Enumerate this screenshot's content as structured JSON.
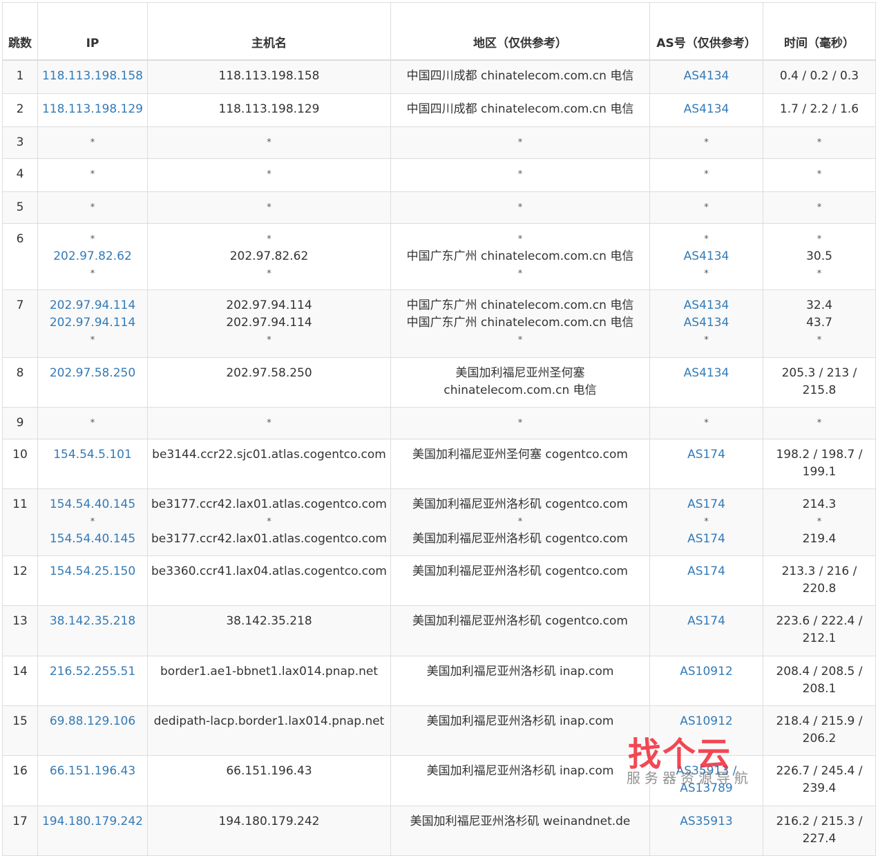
{
  "headers": [
    "跳数",
    "IP",
    "主机名",
    "地区（仅供参考）",
    "AS号（仅供参考）",
    "时间（毫秒）"
  ],
  "link_color": "#337ab7",
  "rows": [
    {
      "hop": "1",
      "ip": [
        "118.113.198.158"
      ],
      "host": [
        "118.113.198.158"
      ],
      "region": [
        "中国四川成都 chinatelecom.com.cn 电信"
      ],
      "asn": [
        "AS4134"
      ],
      "time": [
        "0.4 / 0.2 / 0.3"
      ]
    },
    {
      "hop": "2",
      "ip": [
        "118.113.198.129"
      ],
      "host": [
        "118.113.198.129"
      ],
      "region": [
        "中国四川成都 chinatelecom.com.cn 电信"
      ],
      "asn": [
        "AS4134"
      ],
      "time": [
        "1.7 / 2.2 / 1.6"
      ]
    },
    {
      "hop": "3",
      "ip": [
        "*"
      ],
      "host": [
        "*"
      ],
      "region": [
        "*"
      ],
      "asn": [
        "*"
      ],
      "time": [
        "*"
      ]
    },
    {
      "hop": "4",
      "ip": [
        "*"
      ],
      "host": [
        "*"
      ],
      "region": [
        "*"
      ],
      "asn": [
        "*"
      ],
      "time": [
        "*"
      ]
    },
    {
      "hop": "5",
      "ip": [
        "*"
      ],
      "host": [
        "*"
      ],
      "region": [
        "*"
      ],
      "asn": [
        "*"
      ],
      "time": [
        "*"
      ]
    },
    {
      "hop": "6",
      "ip": [
        "*",
        "202.97.82.62",
        "*"
      ],
      "host": [
        "*",
        "202.97.82.62",
        "*"
      ],
      "region": [
        "*",
        "中国广东广州 chinatelecom.com.cn 电信",
        "*"
      ],
      "asn": [
        "*",
        "AS4134",
        "*"
      ],
      "time": [
        "*",
        "30.5",
        "*"
      ]
    },
    {
      "hop": "7",
      "ip": [
        "202.97.94.114",
        "202.97.94.114",
        "*"
      ],
      "host": [
        "202.97.94.114",
        "202.97.94.114",
        "*"
      ],
      "region": [
        "中国广东广州 chinatelecom.com.cn 电信",
        "中国广东广州 chinatelecom.com.cn 电信",
        "*"
      ],
      "asn": [
        "AS4134",
        "AS4134",
        "*"
      ],
      "time": [
        "32.4",
        "43.7",
        "*"
      ]
    },
    {
      "hop": "8",
      "ip": [
        "202.97.58.250"
      ],
      "host": [
        "202.97.58.250"
      ],
      "region": [
        "美国加利福尼亚州圣何塞",
        "chinatelecom.com.cn 电信"
      ],
      "asn": [
        "AS4134"
      ],
      "time": [
        "205.3 / 213 /",
        "215.8"
      ]
    },
    {
      "hop": "9",
      "ip": [
        "*"
      ],
      "host": [
        "*"
      ],
      "region": [
        "*"
      ],
      "asn": [
        "*"
      ],
      "time": [
        "*"
      ]
    },
    {
      "hop": "10",
      "ip": [
        "154.54.5.101"
      ],
      "host": [
        "be3144.ccr22.sjc01.atlas.cogentco.com"
      ],
      "region": [
        "美国加利福尼亚州圣何塞 cogentco.com"
      ],
      "asn": [
        "AS174"
      ],
      "time": [
        "198.2 / 198.7 /",
        "199.1"
      ]
    },
    {
      "hop": "11",
      "ip": [
        "154.54.40.145",
        "*",
        "154.54.40.145"
      ],
      "host": [
        "be3177.ccr42.lax01.atlas.cogentco.com",
        "*",
        "be3177.ccr42.lax01.atlas.cogentco.com"
      ],
      "region": [
        "美国加利福尼亚州洛杉矶 cogentco.com",
        "*",
        "美国加利福尼亚州洛杉矶 cogentco.com"
      ],
      "asn": [
        "AS174",
        "*",
        "AS174"
      ],
      "time": [
        "214.3",
        "*",
        "219.4"
      ]
    },
    {
      "hop": "12",
      "ip": [
        "154.54.25.150"
      ],
      "host": [
        "be3360.ccr41.lax04.atlas.cogentco.com"
      ],
      "region": [
        "美国加利福尼亚州洛杉矶 cogentco.com"
      ],
      "asn": [
        "AS174"
      ],
      "time": [
        "213.3 / 216 /",
        "220.8"
      ]
    },
    {
      "hop": "13",
      "ip": [
        "38.142.35.218"
      ],
      "host": [
        "38.142.35.218"
      ],
      "region": [
        "美国加利福尼亚州洛杉矶 cogentco.com"
      ],
      "asn": [
        "AS174"
      ],
      "time": [
        "223.6 / 222.4 /",
        "212.1"
      ]
    },
    {
      "hop": "14",
      "ip": [
        "216.52.255.51"
      ],
      "host": [
        "border1.ae1-bbnet1.lax014.pnap.net"
      ],
      "region": [
        "美国加利福尼亚州洛杉矶 inap.com"
      ],
      "asn": [
        "AS10912"
      ],
      "time": [
        "208.4 / 208.5 /",
        "208.1"
      ]
    },
    {
      "hop": "15",
      "ip": [
        "69.88.129.106"
      ],
      "host": [
        "dedipath-lacp.border1.lax014.pnap.net"
      ],
      "region": [
        "美国加利福尼亚州洛杉矶 inap.com"
      ],
      "asn": [
        "AS10912"
      ],
      "time": [
        "218.4 / 215.9 /",
        "206.2"
      ]
    },
    {
      "hop": "16",
      "ip": [
        "66.151.196.43"
      ],
      "host": [
        "66.151.196.43"
      ],
      "region": [
        "美国加利福尼亚州洛杉矶 inap.com"
      ],
      "asn": [
        "AS35913 /",
        "AS13789"
      ],
      "time": [
        "226.7 / 245.4 /",
        "239.4"
      ]
    },
    {
      "hop": "17",
      "ip": [
        "194.180.179.242"
      ],
      "host": [
        "194.180.179.242"
      ],
      "region": [
        "美国加利福尼亚州洛杉矶 weinandnet.de"
      ],
      "asn": [
        "AS35913"
      ],
      "time": [
        "216.2 / 215.3 /",
        "227.4"
      ]
    }
  ],
  "watermark": {
    "logo": "找个云",
    "subtitle": "服务器资源导航"
  }
}
